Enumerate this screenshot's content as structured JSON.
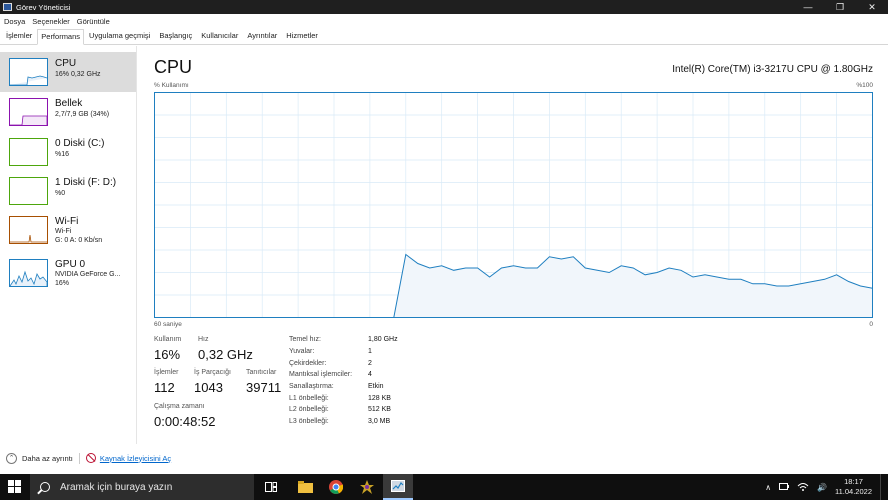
{
  "window": {
    "title": "Görev Yöneticisi",
    "minimize": "—",
    "maximize": "❐",
    "close": "✕"
  },
  "menu": [
    "Dosya",
    "Seçenekler",
    "Görüntüle"
  ],
  "tabs": [
    "İşlemler",
    "Performans",
    "Uygulama geçmişi",
    "Başlangıç",
    "Kullanıcılar",
    "Ayrıntılar",
    "Hizmetler"
  ],
  "active_tab": "Performans",
  "sidebar": {
    "items": [
      {
        "name": "CPU",
        "lines": [
          "16% 0,32 GHz"
        ],
        "color": "#1f7fc0"
      },
      {
        "name": "Bellek",
        "lines": [
          "2,7/7,9 GB (34%)"
        ],
        "color": "#8b12ae"
      },
      {
        "name": "0 Diski (C:)",
        "lines": [
          "%16"
        ],
        "color": "#4da60c"
      },
      {
        "name": "1 Diski (F: D:)",
        "lines": [
          "%0"
        ],
        "color": "#4da60c"
      },
      {
        "name": "Wi-Fi",
        "lines": [
          "Wi-Fi",
          "G: 0 A: 0 Kb/sn"
        ],
        "color": "#a74f01"
      },
      {
        "name": "GPU 0",
        "lines": [
          "NVIDIA GeForce G...",
          "16%"
        ],
        "color": "#1f7fc0"
      }
    ]
  },
  "main": {
    "title": "CPU",
    "model": "Intel(R) Core(TM) i3-3217U CPU @ 1.80GHz",
    "graph_label_left": "% Kullanımı",
    "graph_label_right": "%100",
    "time_label": "60 saniye",
    "zero_label": "0",
    "line_color": "#1f7fc0",
    "fill_color": "#f1f6fb"
  },
  "chart_data": {
    "type": "area",
    "ylim": [
      0,
      100
    ],
    "xlim": [
      60,
      0
    ],
    "x": [
      60,
      40,
      39,
      38,
      37,
      36,
      35,
      34,
      33,
      32,
      31,
      30,
      29,
      28,
      27,
      26,
      25,
      24,
      23,
      22,
      21,
      20,
      19,
      18,
      17,
      16,
      15,
      14,
      13,
      12,
      11,
      10,
      9,
      8,
      7,
      6,
      5,
      4,
      3,
      2,
      1,
      0
    ],
    "values": [
      0,
      0,
      28,
      24,
      22,
      23,
      21,
      22,
      22,
      18,
      22,
      23,
      22,
      22,
      27,
      26,
      27,
      22,
      21,
      20,
      23,
      22,
      19,
      20,
      22,
      21,
      18,
      19,
      18,
      17,
      17,
      15,
      15,
      14,
      14,
      15,
      16,
      17,
      19,
      16,
      14,
      13
    ]
  },
  "stats": {
    "utilization_label": "Kullanım",
    "utilization": "16%",
    "speed_label": "Hız",
    "speed": "0,32 GHz",
    "processes_label": "İşlemler",
    "processes": "112",
    "threads_label": "İş Parçacığı",
    "threads": "1043",
    "handles_label": "Tanıtıcılar",
    "handles": "39711",
    "uptime_label": "Çalışma zamanı",
    "uptime": "0:00:48:52"
  },
  "specs": [
    {
      "label": "Temel hız:",
      "value": "1,80 GHz"
    },
    {
      "label": "Yuvalar:",
      "value": "1"
    },
    {
      "label": "Çekirdekler:",
      "value": "2"
    },
    {
      "label": "Mantıksal işlemciler:",
      "value": "4"
    },
    {
      "label": "Sanallaştırma:",
      "value": "Etkin"
    },
    {
      "label": "L1 önbelleği:",
      "value": "128 KB"
    },
    {
      "label": "L2 önbelleği:",
      "value": "512 KB"
    },
    {
      "label": "L3 önbelleği:",
      "value": "3,0 MB"
    }
  ],
  "footer": {
    "less_details": "Daha az ayrıntı",
    "resource_monitor": "Kaynak İzleyicisini Aç",
    "less_glyph": "⌃"
  },
  "taskbar": {
    "search_placeholder": "Aramak için buraya yazın",
    "time": "18:17",
    "date": "11.04.2022",
    "tray_chevron": "∧",
    "volume_glyph": "🔊"
  }
}
